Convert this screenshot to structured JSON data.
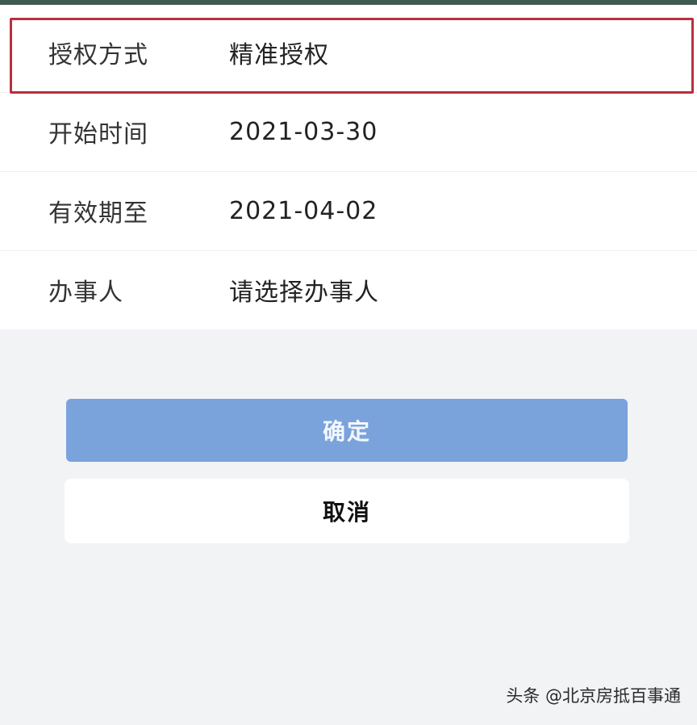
{
  "form": {
    "rows": [
      {
        "label": "授权方式",
        "value": "精准授权"
      },
      {
        "label": "开始时间",
        "value": "2021-03-30"
      },
      {
        "label": "有效期至",
        "value": "2021-04-02"
      },
      {
        "label": "办事人",
        "value": "请选择办事人"
      }
    ]
  },
  "actions": {
    "confirm_label": "确定",
    "cancel_label": "取消"
  },
  "watermark": {
    "text": "头条 @北京房抵百事通"
  },
  "colors": {
    "highlight_border": "#b8303f",
    "confirm_bg": "#7aa3dc"
  }
}
